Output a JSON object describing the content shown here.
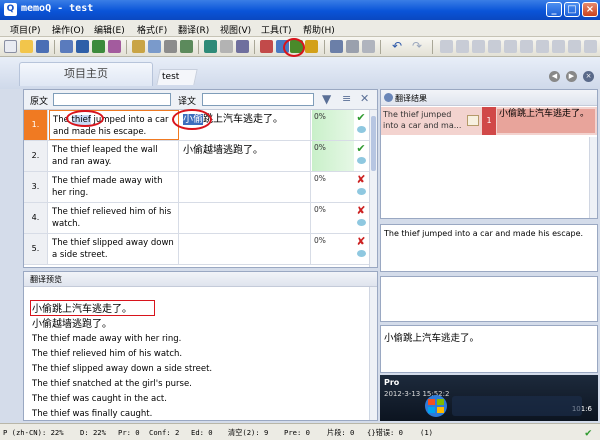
{
  "window": {
    "title": "memoQ - test",
    "minimize": "_",
    "maximize": "□",
    "close": "×"
  },
  "menu": [
    "项目(P)",
    "操作(O)",
    "编辑(E)",
    "格式(F)",
    "翻译(R)",
    "视图(V)",
    "工具(T)",
    "帮助(H)"
  ],
  "tabs": {
    "home": "项目主页",
    "doc": "test"
  },
  "filter": {
    "source_label": "原文",
    "target_label": "译文"
  },
  "rows": [
    {
      "num": "1.",
      "src_pre": "The ",
      "src_hl": "thief",
      "src_post": " jumped into a car and made his escape.",
      "tgt_hl": "小偷",
      "tgt_post": "跳上汽车逃走了。",
      "pct": "0%",
      "status": "✔"
    },
    {
      "num": "2.",
      "src": "The thief leaped the wall and ran away.",
      "tgt": "小偷越墙逃跑了。",
      "pct": "0%",
      "status": "✔"
    },
    {
      "num": "3.",
      "src": "The thief made away with her ring.",
      "tgt": "",
      "pct": "0%",
      "status": "✘"
    },
    {
      "num": "4.",
      "src": "The thief relieved him of his watch.",
      "tgt": "",
      "pct": "0%",
      "status": "✘"
    },
    {
      "num": "5.",
      "src": "The thief slipped away down a side street.",
      "tgt": "",
      "pct": "0%",
      "status": "✘"
    }
  ],
  "preview": {
    "title": "翻译预览",
    "lines": [
      "小偷跳上汽车逃走了。",
      "小偷越墙逃跑了。",
      "The thief made away with her ring.",
      "The thief relieved him of his watch.",
      "The thief slipped away down a side street.",
      "The thief snatched at the girl's purse.",
      "The thief was caught in the act.",
      "The thief was finally caught."
    ]
  },
  "results": {
    "title": "翻译结果",
    "hit_src": "The thief jumped into a car and ma...",
    "hit_num": "1",
    "hit_tgt": "小偷跳上汽车逃走了。"
  },
  "compare_src": "The thief jumped into a car and made his escape.",
  "compare_tgt": "小偷跳上汽车逃走了。",
  "video": {
    "label": "Pro",
    "time": "2012-3-13 15:52:2",
    "num": "101:6"
  },
  "status": [
    "P (zh-CN): 22%",
    "D: 22%",
    "Pr: 0",
    "Conf: 2",
    "Ed: 0",
    "清空(2): 9",
    "Pre: 0",
    "片段: 0",
    "{}错误: 0",
    "(1)"
  ],
  "colors": {
    "active_row": "#f07a22",
    "highlight": "#3d6dbd",
    "match_green": "#c9f0c9",
    "result_red": "#d14848",
    "annotation_red": "#d8141c"
  }
}
